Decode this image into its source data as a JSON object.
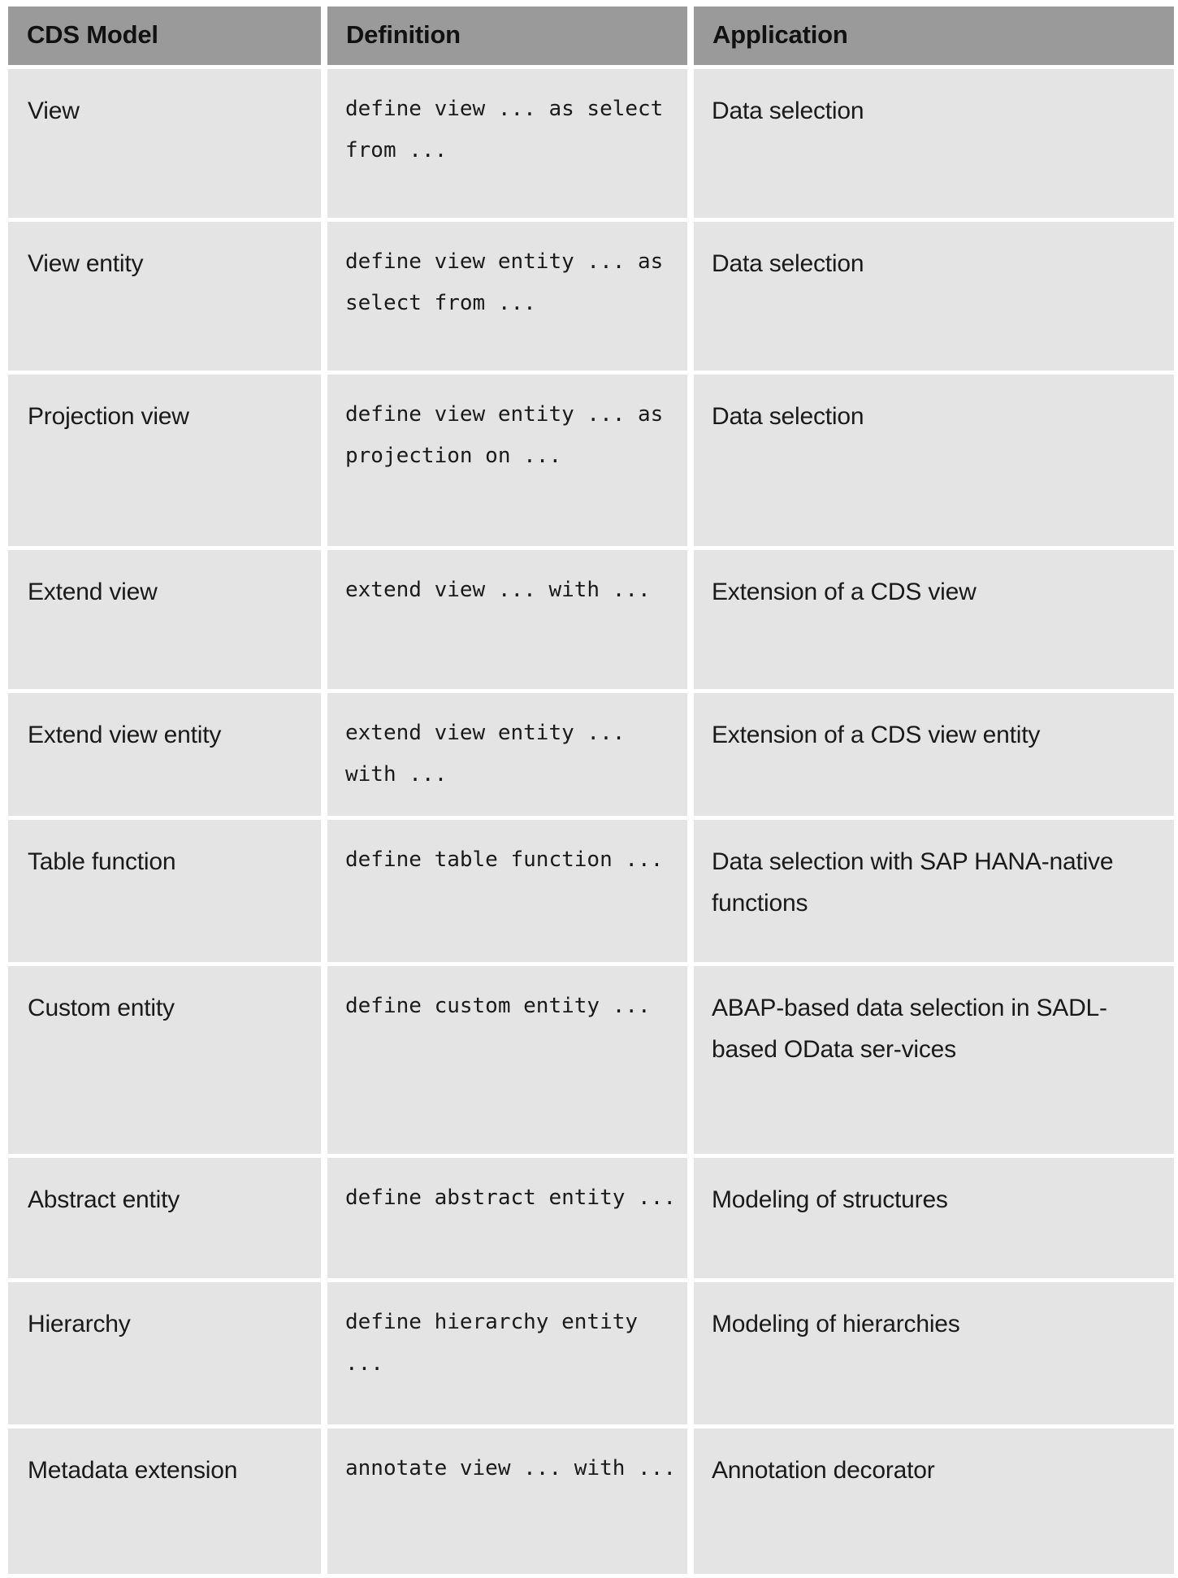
{
  "table": {
    "headers": [
      "CDS Model",
      "Definition",
      "Application"
    ],
    "rows": [
      {
        "model": "View",
        "definition": "define view ... as select from ...",
        "application": "Data selection"
      },
      {
        "model": "View entity",
        "definition": "define view entity ... as select from ...",
        "application": "Data selection"
      },
      {
        "model": "Projection view",
        "definition": "define view entity ... as projection on ...",
        "application": "Data selection"
      },
      {
        "model": "Extend view",
        "definition": "extend view ... with ...",
        "application": "Extension of a CDS view"
      },
      {
        "model": "Extend view entity",
        "definition": "extend view entity ... with ...",
        "application": "Extension of a CDS view entity"
      },
      {
        "model": "Table function",
        "definition": "define table function ...",
        "application": "Data selection with SAP HANA-native functions"
      },
      {
        "model": "Custom entity",
        "definition": "define custom entity ...",
        "application": "ABAP-based data selection in SADL-based OData ser-vices"
      },
      {
        "model": "Abstract entity",
        "definition": "define abstract entity ...",
        "application": "Modeling of structures"
      },
      {
        "model": "Hierarchy",
        "definition": "define hierarchy entity ...",
        "application": "Modeling of hierarchies"
      },
      {
        "model": "Metadata extension",
        "definition": "annotate view ... with ...",
        "application": "Annotation decorator"
      }
    ]
  },
  "colors": {
    "header_bg": "#9a9a9a",
    "cell_bg": "#e4e4e4",
    "text": "#1a1a1a",
    "page_bg": "#ffffff"
  }
}
